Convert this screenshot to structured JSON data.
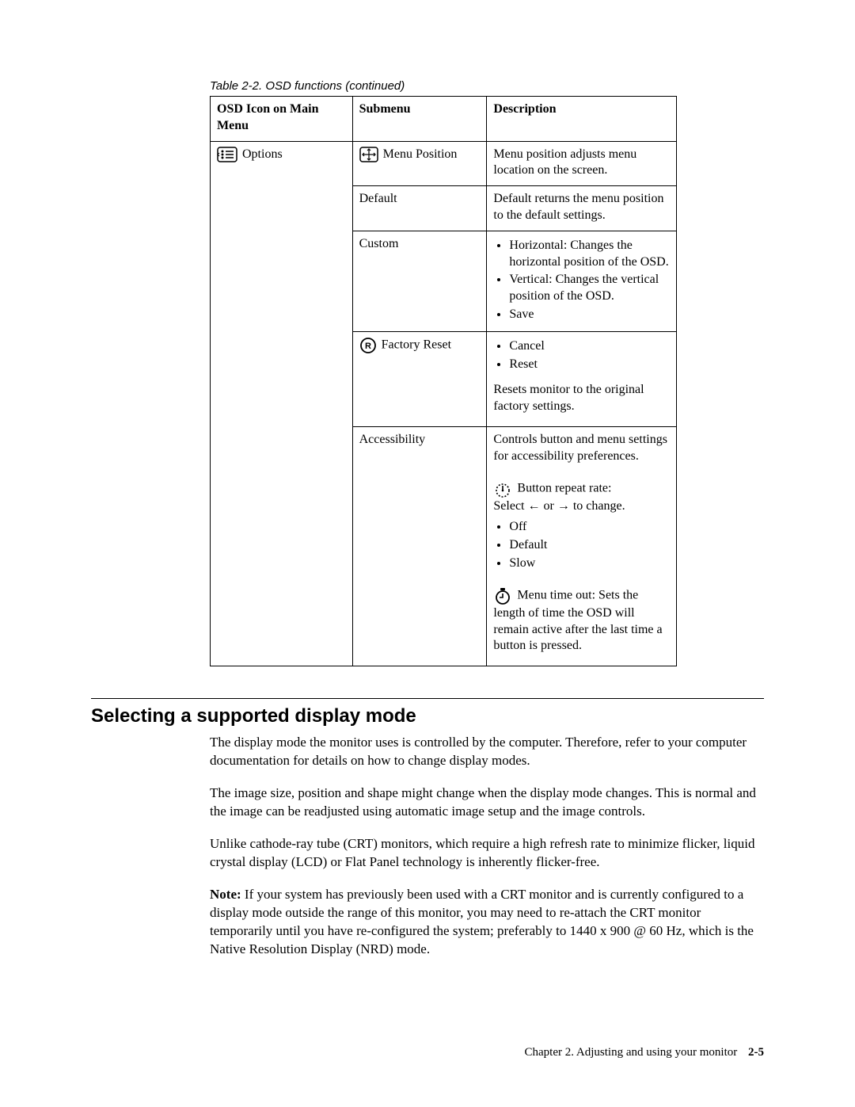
{
  "table": {
    "caption": "Table 2-2. OSD functions (continued)",
    "headers": {
      "main": "OSD Icon on Main Menu",
      "sub": "Submenu",
      "desc": "Description"
    },
    "main_label": "Options",
    "rows": {
      "menu_position": {
        "submenu": "Menu Position",
        "desc": "Menu position adjusts menu location on the screen."
      },
      "default": {
        "submenu": "Default",
        "desc": "Default returns the menu position to the default settings."
      },
      "custom": {
        "submenu": "Custom",
        "bullets": {
          "b1": "Horizontal: Changes the horizontal position of the OSD.",
          "b2": "Vertical: Changes the vertical position of the OSD.",
          "b3": "Save"
        }
      },
      "factory_reset": {
        "submenu": "Factory Reset",
        "bullets": {
          "b1": "Cancel",
          "b2": "Reset"
        },
        "after": "Resets monitor to the original factory settings."
      },
      "accessibility": {
        "submenu": "Accessibility",
        "intro": "Controls button and menu settings for accessibility preferences.",
        "repeat_label": "Button repeat rate:",
        "repeat_select_prefix": "Select",
        "repeat_select_middle": "or",
        "repeat_select_suffix": "to change.",
        "repeat_bullets": {
          "b1": "Off",
          "b2": "Default",
          "b3": "Slow"
        },
        "timeout": "Menu time out: Sets the length of time the OSD will remain active after the last time a button is pressed."
      }
    }
  },
  "section": {
    "heading": "Selecting a supported display mode",
    "p1": "The display mode the monitor uses is controlled by the computer. Therefore, refer to your computer documentation for details on how to change display modes.",
    "p2": "The image size, position and shape might change when the display mode changes. This is normal and the image can be readjusted using automatic image setup and the image controls.",
    "p3": "Unlike cathode-ray tube (CRT) monitors, which require a high refresh rate to minimize flicker, liquid crystal display (LCD) or Flat Panel technology is inherently flicker-free.",
    "note_label": "Note:",
    "note_body": "If your system has previously been used with a CRT monitor and is currently configured to a display mode outside the range of this monitor, you may need to re-attach the CRT monitor temporarily until you have re-configured the system; preferably to 1440 x 900 @ 60 Hz, which is the Native Resolution Display (NRD) mode."
  },
  "footer": {
    "chapter": "Chapter 2. Adjusting and using your monitor",
    "page": "2-5"
  }
}
